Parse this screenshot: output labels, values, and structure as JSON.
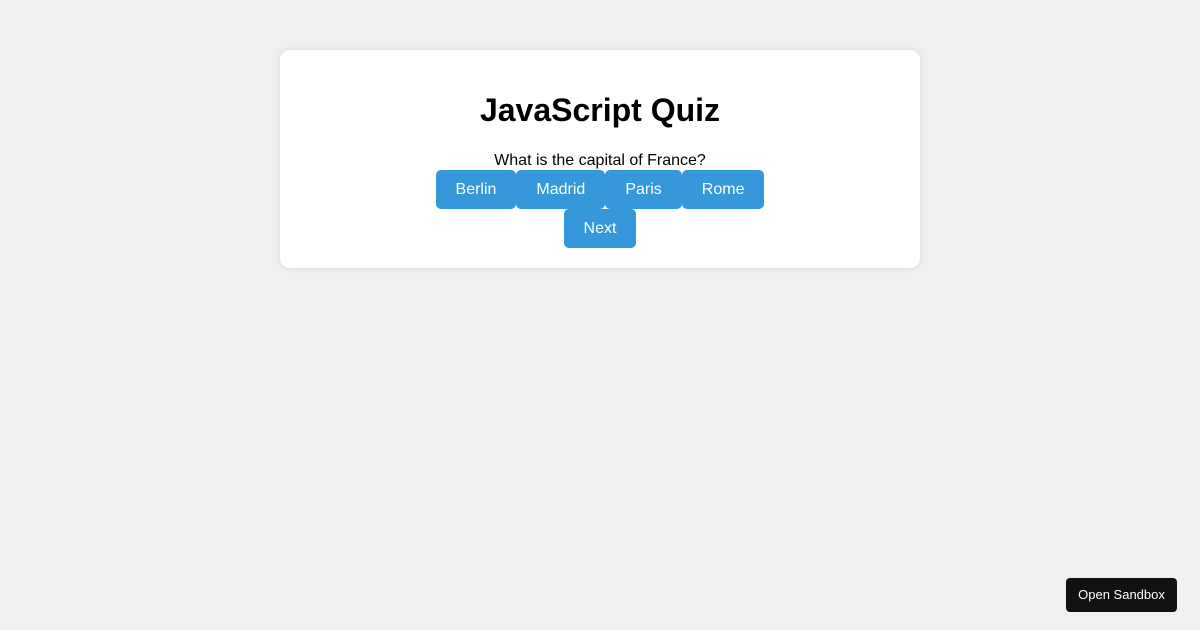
{
  "quiz": {
    "title": "JavaScript Quiz",
    "question": "What is the capital of France?",
    "options": [
      "Berlin",
      "Madrid",
      "Paris",
      "Rome"
    ],
    "next_label": "Next"
  },
  "sandbox": {
    "label": "Open Sandbox"
  },
  "colors": {
    "background": "#f0f0f0",
    "card": "#ffffff",
    "button": "#3498db",
    "sandbox_button": "#111111"
  }
}
